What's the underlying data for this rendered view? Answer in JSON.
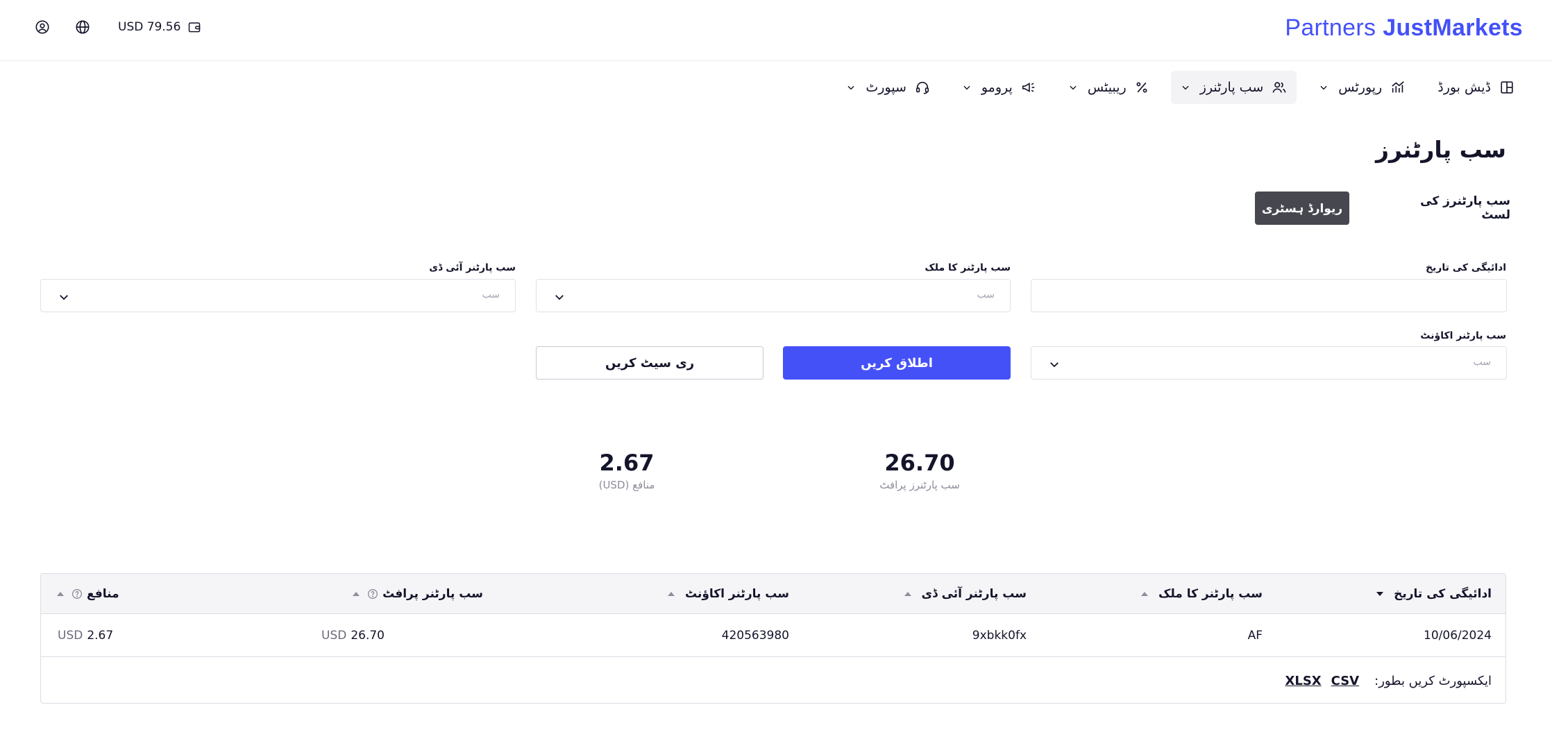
{
  "header": {
    "balance": "USD 79.56",
    "logo_partners": "Partners",
    "logo_brand": "JustMarkets",
    "icons": [
      "user-circle-icon",
      "globe-icon",
      "wallet-icon"
    ]
  },
  "nav": {
    "items": [
      {
        "label": "ڈیش بورڈ",
        "icon": "layout-icon"
      },
      {
        "label": "رپورٹس",
        "icon": "chart-icon"
      },
      {
        "label": "سب پارٹنرز",
        "icon": "users-icon"
      },
      {
        "label": "ریبیٹس",
        "icon": "percent-icon"
      },
      {
        "label": "پرومو",
        "icon": "megaphone-icon"
      },
      {
        "label": "سپورٹ",
        "icon": "headset-icon"
      }
    ]
  },
  "page": {
    "title": "سب پارٹنرز",
    "tabs": {
      "list": "سب پارٹنرز کی لسٹ",
      "history": "ریوارڈ ہسٹری"
    }
  },
  "filters": {
    "payment_date_label": "ادائیگی کی تاریخ",
    "payment_date_value": "",
    "country_label": "سب پارٹنر کا ملک",
    "country_placeholder": "سب",
    "id_label": "سب پارٹنر آئی ڈی",
    "id_placeholder": "سب",
    "account_label": "سب پارٹنر اکاؤنٹ",
    "account_placeholder": "سب",
    "apply": "اطلاق کریں",
    "reset": "ری سیٹ کریں"
  },
  "stats": {
    "profit_value": "26.70",
    "profit_label": "سب پارٹنرز پرافٹ",
    "benefit_value": "2.67",
    "benefit_label": "منافع (USD)"
  },
  "table": {
    "headers": {
      "payment_date": "ادائیگی کی تاریخ",
      "country": "سب پارٹنر کا ملک",
      "id": "سب پارٹنر آئی ڈی",
      "account": "سب پارٹنر اکاؤنٹ",
      "profit": "سب پارٹنر پرافٹ",
      "benefit": "منافع"
    },
    "rows": [
      {
        "payment_date": "10/06/2024",
        "country": "AF",
        "id": "9xbkk0fx",
        "account": "420563980",
        "profit_currency": "USD",
        "profit_value": "26.70",
        "benefit_currency": "USD",
        "benefit_value": "2.67"
      }
    ],
    "export_label": "ایکسپورٹ کریں بطور:",
    "export_csv": "CSV",
    "export_xlsx": "XLSX"
  },
  "colors": {
    "accent": "#4451f7",
    "tab_active_bg": "#474750",
    "border": "#dcdce3"
  }
}
